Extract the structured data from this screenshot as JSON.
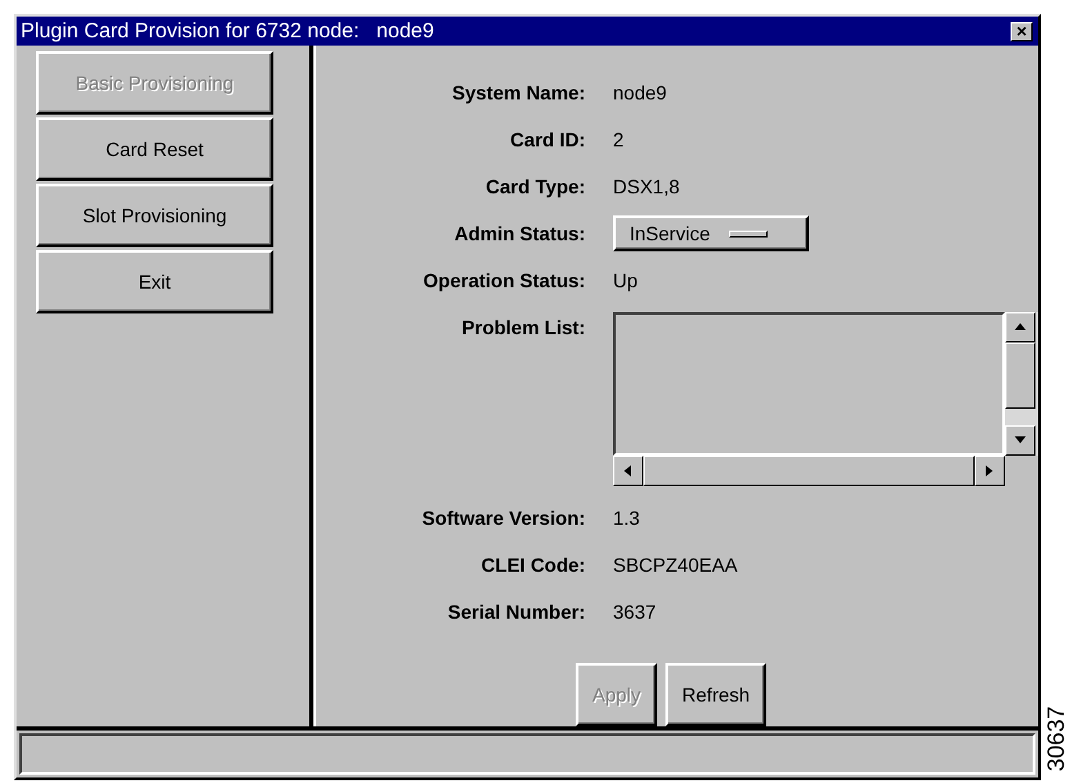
{
  "window": {
    "title": "Plugin Card Provision for 6732 node:   node9",
    "close": "×"
  },
  "nav_buttons": [
    {
      "label": "Basic Provisioning",
      "disabled": true
    },
    {
      "label": "Card Reset",
      "disabled": false
    },
    {
      "label": "Slot Provisioning",
      "disabled": false
    },
    {
      "label": "Exit",
      "disabled": false
    }
  ],
  "fields": [
    {
      "kind": "text",
      "label": "System Name:",
      "value": "node9"
    },
    {
      "kind": "text",
      "label": "Card ID:",
      "value": "2"
    },
    {
      "kind": "text",
      "label": "Card Type:",
      "value": "DSX1,8"
    },
    {
      "kind": "dropdown",
      "label": "Admin Status:",
      "value": "InService"
    },
    {
      "kind": "text",
      "label": "Operation Status:",
      "value": "Up"
    },
    {
      "kind": "list",
      "label": "Problem List:"
    },
    {
      "kind": "text",
      "label": "Software Version:",
      "value": "1.3"
    },
    {
      "kind": "text",
      "label": "CLEI Code:",
      "value": "SBCPZ40EAA"
    },
    {
      "kind": "text",
      "label": "Serial Number:",
      "value": "3637"
    }
  ],
  "buttons": [
    {
      "label": "Apply",
      "disabled": true
    },
    {
      "label": "Refresh",
      "disabled": false
    }
  ],
  "figure_number": "30637"
}
